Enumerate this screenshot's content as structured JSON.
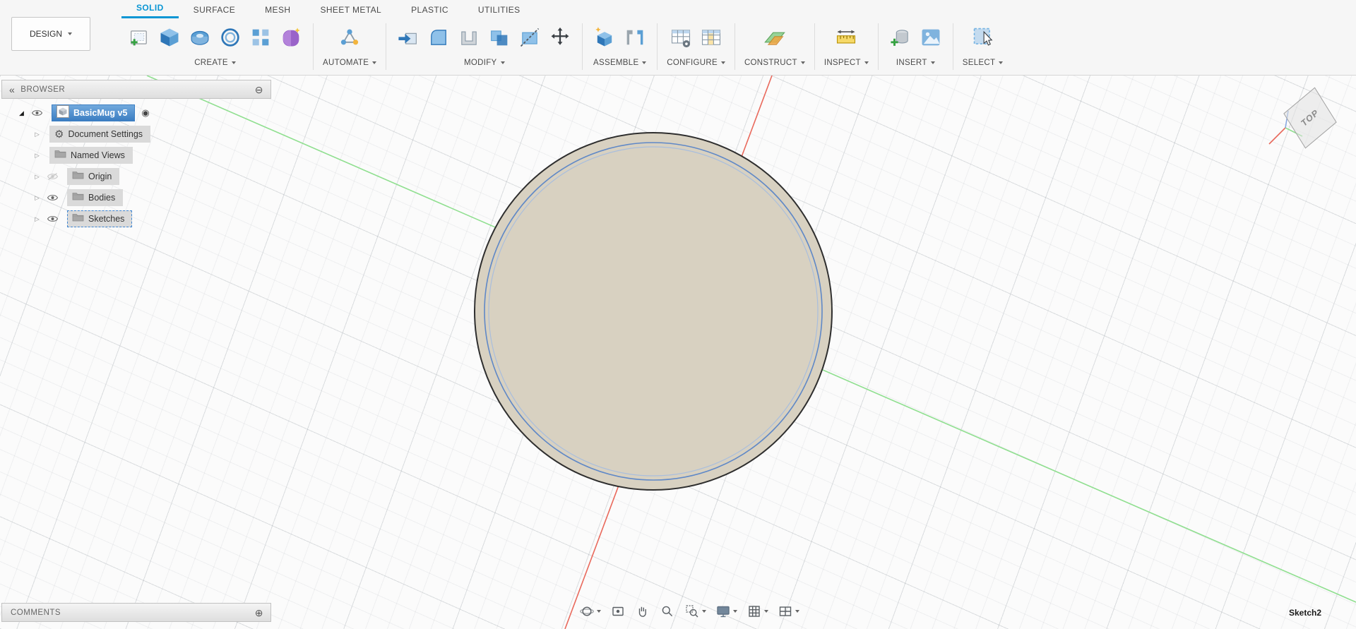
{
  "tabs": [
    {
      "label": "SOLID",
      "active": true
    },
    {
      "label": "SURFACE",
      "active": false
    },
    {
      "label": "MESH",
      "active": false
    },
    {
      "label": "SHEET METAL",
      "active": false
    },
    {
      "label": "PLASTIC",
      "active": false
    },
    {
      "label": "UTILITIES",
      "active": false
    }
  ],
  "design_menu": {
    "label": "DESIGN"
  },
  "toolbar": {
    "groups": [
      {
        "label": "CREATE",
        "icons": [
          "create-sketch",
          "box",
          "revolve",
          "coil",
          "rectangular-pattern",
          "create-form"
        ]
      },
      {
        "label": "AUTOMATE",
        "icons": [
          "automate"
        ]
      },
      {
        "label": "MODIFY",
        "icons": [
          "press-pull",
          "fillet",
          "shell",
          "combine",
          "split-body",
          "move-copy"
        ]
      },
      {
        "label": "ASSEMBLE",
        "icons": [
          "new-component",
          "joint"
        ]
      },
      {
        "label": "CONFIGURE",
        "icons": [
          "configure",
          "configuration-table"
        ]
      },
      {
        "label": "CONSTRUCT",
        "icons": [
          "offset-plane"
        ]
      },
      {
        "label": "INSPECT",
        "icons": [
          "measure"
        ]
      },
      {
        "label": "INSERT",
        "icons": [
          "insert-derive",
          "canvas"
        ]
      },
      {
        "label": "SELECT",
        "icons": [
          "select"
        ]
      }
    ]
  },
  "browser": {
    "title": "BROWSER",
    "root": {
      "label": "BasicMug v5",
      "selected": true
    },
    "items": [
      {
        "label": "Document Settings",
        "icon": "gear"
      },
      {
        "label": "Named Views",
        "icon": "folder"
      },
      {
        "label": "Origin",
        "icon": "folder",
        "visibility": "hidden"
      },
      {
        "label": "Bodies",
        "icon": "folder",
        "visibility": "visible"
      },
      {
        "label": "Sketches",
        "icon": "folder",
        "visibility": "visible",
        "active_edit": true
      }
    ]
  },
  "comments": {
    "title": "COMMENTS"
  },
  "viewport": {
    "viewcube_face": "TOP",
    "active_sketch_badge": "Sketch2",
    "navbar_icons": [
      "orbit",
      "look-at",
      "pan",
      "zoom",
      "zoom-window",
      "display-settings",
      "grid-display",
      "viewports"
    ]
  },
  "icons": {
    "expanded": "◢",
    "collapsed": "▷",
    "gear": "⚙",
    "radio": "◉",
    "collapse_panel": "«",
    "minimize": "⊖",
    "add_comment": "⊕"
  },
  "colors": {
    "accent_blue": "#0a96d4",
    "selection_blue": "#4a86c8",
    "axis_red": "#e9695c",
    "axis_green": "#8fdf8f",
    "body_fill": "#d8d1c1",
    "sketch_line": "#5f88c7"
  }
}
